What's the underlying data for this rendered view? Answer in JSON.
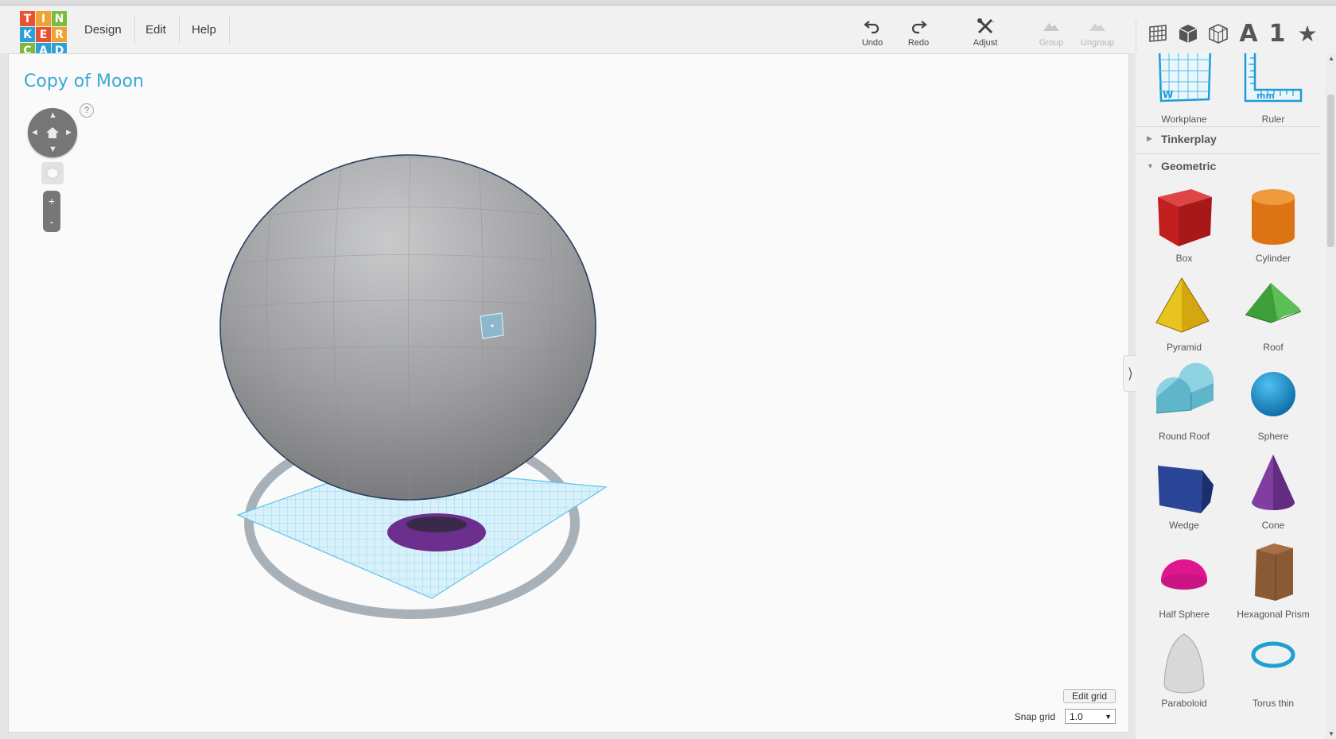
{
  "logo": {
    "letters": [
      "T",
      "I",
      "N",
      "K",
      "E",
      "R",
      "C",
      "A",
      "D"
    ],
    "colors": [
      "#e8522e",
      "#f0a231",
      "#7cba3e",
      "#2c9ed8",
      "#e8522e",
      "#f0a231",
      "#7cba3e",
      "#2c9ed8",
      "#2c9ed8"
    ]
  },
  "menu": {
    "design": "Design",
    "edit": "Edit",
    "help": "Help"
  },
  "toolbar": {
    "undo": "Undo",
    "redo": "Redo",
    "adjust": "Adjust",
    "group": "Group",
    "ungroup": "Ungroup"
  },
  "view_buttons": {
    "letter": "A",
    "number": "1",
    "favorites": "★"
  },
  "document": {
    "title": "Copy of Moon"
  },
  "nav": {
    "help": "?",
    "zoom_in": "+",
    "zoom_out": "-"
  },
  "grid": {
    "edit_label": "Edit grid",
    "snap_label": "Snap grid",
    "snap_value": "1.0"
  },
  "panel": {
    "helpers": [
      {
        "label": "Workplane",
        "icon": "workplane-icon"
      },
      {
        "label": "Ruler",
        "icon": "ruler-icon"
      }
    ],
    "sections": [
      {
        "title": "Tinkerplay",
        "expanded": false
      },
      {
        "title": "Geometric",
        "expanded": true
      }
    ],
    "shapes": [
      {
        "label": "Box",
        "icon": "box-icon",
        "color": "#d42a2a"
      },
      {
        "label": "Cylinder",
        "icon": "cylinder-icon",
        "color": "#e8821a"
      },
      {
        "label": "Pyramid",
        "icon": "pyramid-icon",
        "color": "#e8c51e"
      },
      {
        "label": "Roof",
        "icon": "roof-icon",
        "color": "#3e9e3a"
      },
      {
        "label": "Round Roof",
        "icon": "round-roof-icon",
        "color": "#6cc3d6"
      },
      {
        "label": "Sphere",
        "icon": "sphere-icon",
        "color": "#1e94d2"
      },
      {
        "label": "Wedge",
        "icon": "wedge-icon",
        "color": "#263e8a"
      },
      {
        "label": "Cone",
        "icon": "cone-icon",
        "color": "#7a3a9a"
      },
      {
        "label": "Half Sphere",
        "icon": "half-sphere-icon",
        "color": "#e0168e"
      },
      {
        "label": "Hexagonal Prism",
        "icon": "hexagonal-prism-icon",
        "color": "#8a5a34"
      },
      {
        "label": "Paraboloid",
        "icon": "paraboloid-icon",
        "color": "#d8d8d8"
      },
      {
        "label": "Torus thin",
        "icon": "torus-thin-icon",
        "color": "#1ea0d2"
      }
    ]
  }
}
